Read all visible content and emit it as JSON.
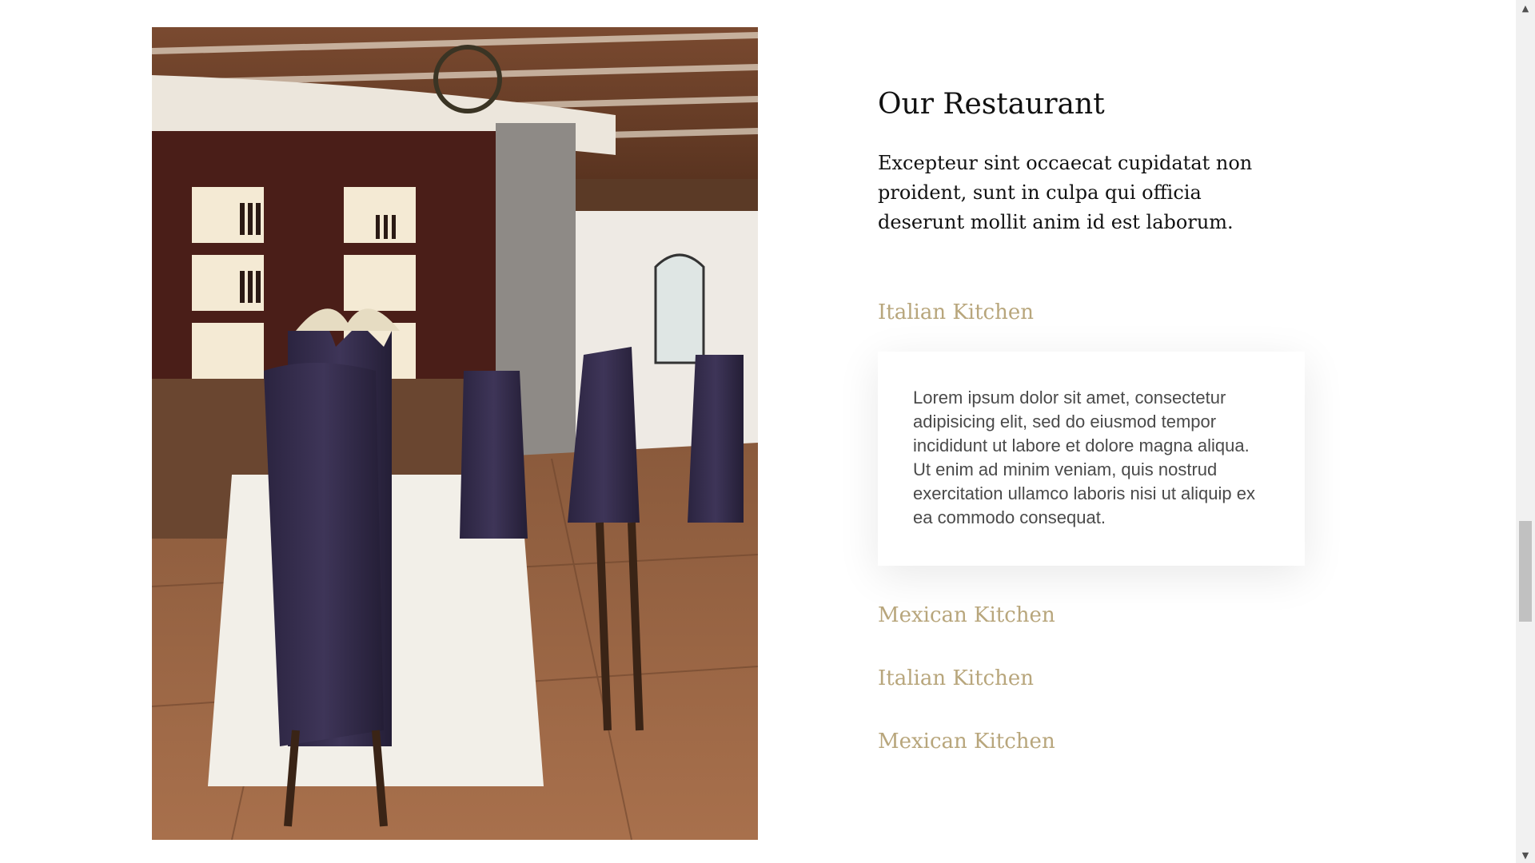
{
  "section": {
    "title": "Our Restaurant",
    "intro": "Excepteur sint occaecat cupidatat non proident, sunt in culpa qui officia deserunt mollit anim id est laborum."
  },
  "tabs": [
    {
      "label": "Italian Kitchen",
      "active": true
    },
    {
      "label": "Mexican Kitchen",
      "active": false
    },
    {
      "label": "Italian Kitchen",
      "active": false
    },
    {
      "label": "Mexican Kitchen",
      "active": false
    }
  ],
  "panel": {
    "text": "Lorem ipsum dolor sit amet, consectetur adipisicing elit, sed do eiusmod tempor incididunt ut labore et dolore magna aliqua. Ut enim ad minim veniam, quis nostrud exercitation ullamco laboris nisi ut aliquip ex ea commodo consequat."
  },
  "image": {
    "icon": "restaurant-photo"
  },
  "colors": {
    "accent": "#b8a67c",
    "heading": "#111111",
    "body_text": "#4a4a4a",
    "background": "#ffffff"
  },
  "scrollbar": {
    "up_icon": "triangle-up-icon",
    "down_icon": "triangle-down-icon"
  }
}
